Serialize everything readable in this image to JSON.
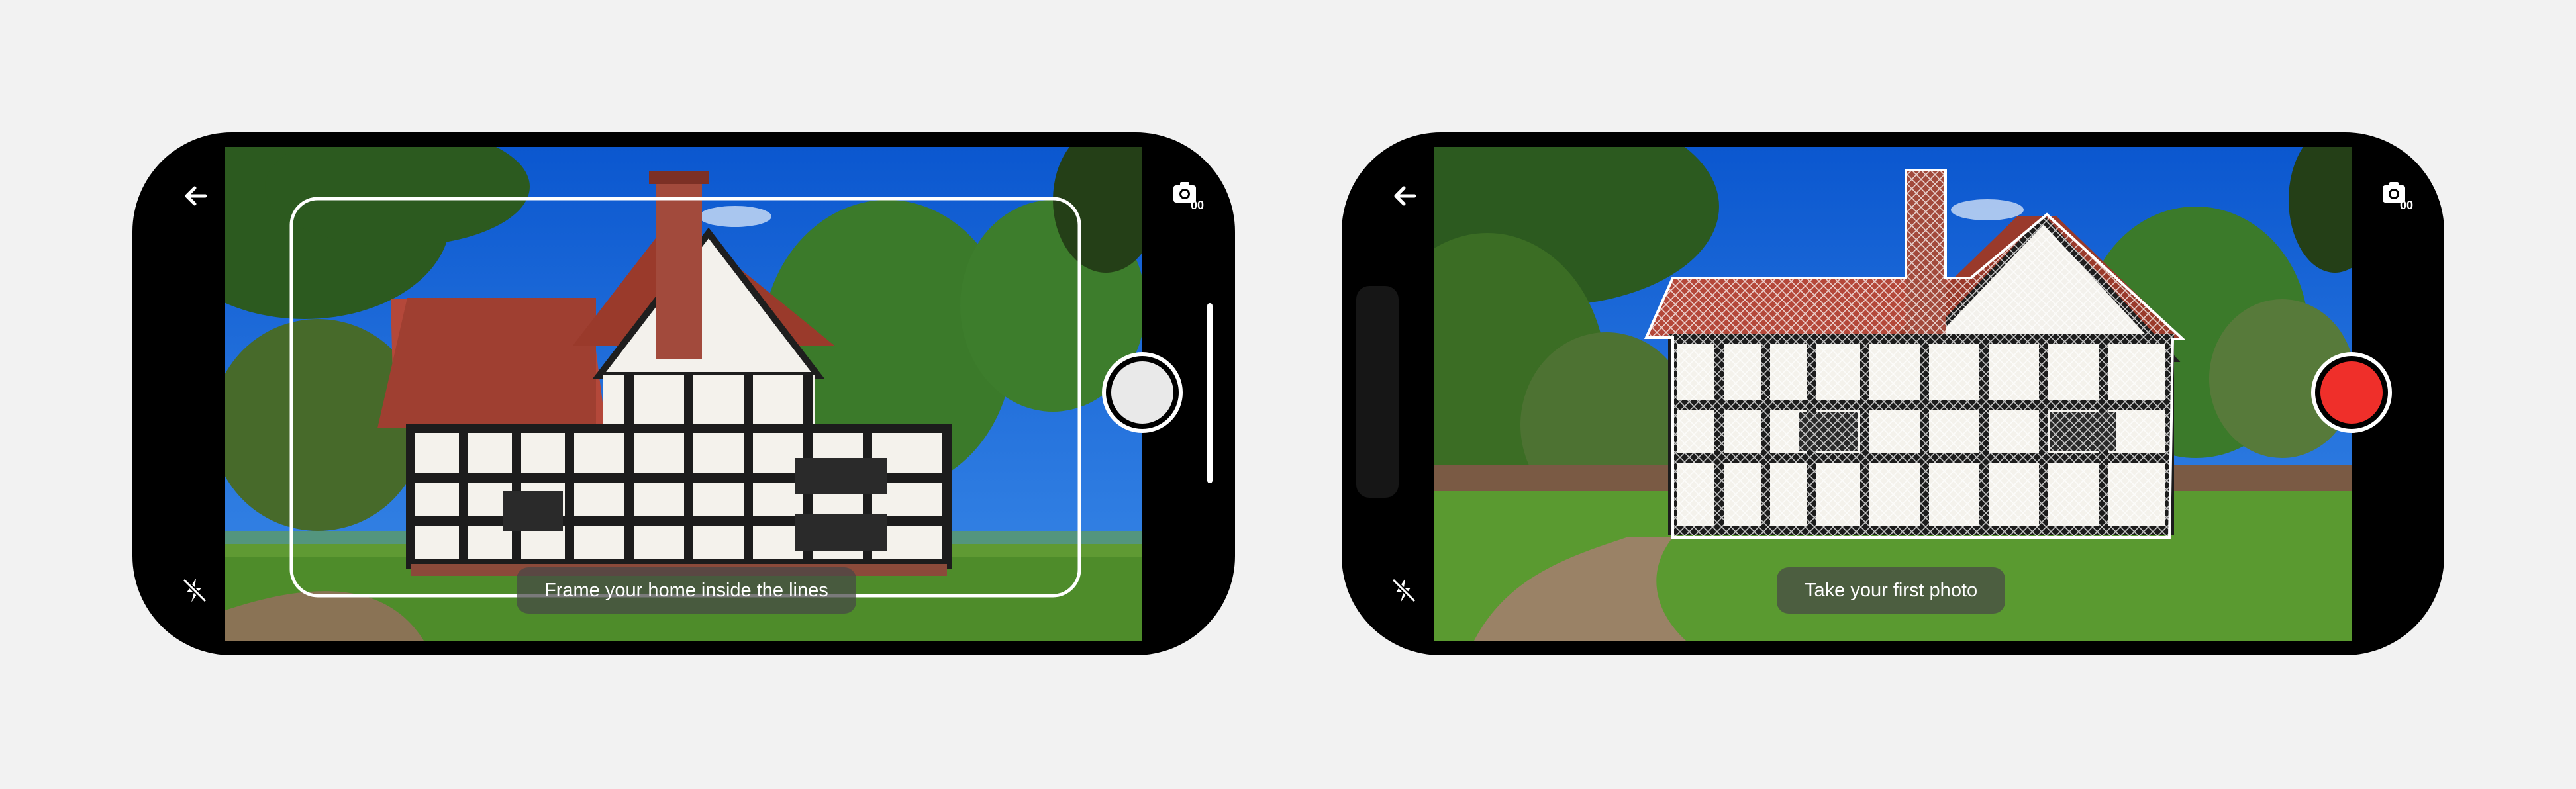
{
  "screens": [
    {
      "name": "frame-screen",
      "hint": "Frame your home inside the lines",
      "shutter_state": "idle",
      "zoom_slider_visible": true
    },
    {
      "name": "capture-screen",
      "hint": "Take your first photo",
      "shutter_state": "ready",
      "zoom_slider_visible": false
    }
  ],
  "camera_badge": "00",
  "icons": {
    "back": "arrow-left-icon",
    "flash": "flash-off-icon",
    "camera": "camera-icon"
  },
  "colors": {
    "background": "#f2f2f2",
    "phone": "#000000",
    "shutter_ready": "#ef2f2a",
    "shutter_idle": "#e9e9e9",
    "hint_bg": "rgba(70,70,70,0.72)"
  }
}
